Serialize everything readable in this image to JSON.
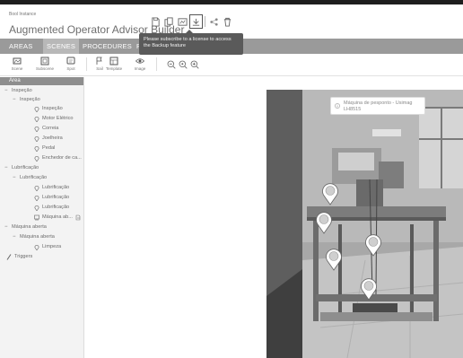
{
  "app": {
    "logo_text": "Bool Instance",
    "title": "Augmented Operator Advisor Builder"
  },
  "header": {
    "icons": [
      "save-icon",
      "copy-icon",
      "publish-icon",
      "backup-icon",
      "share-icon",
      "delete-icon"
    ]
  },
  "tooltip": {
    "text": "Please subscribe to a license to access the Backup feature"
  },
  "nav": {
    "tabs": [
      "AREAS",
      "SCENES",
      "PROCEDURES",
      "P"
    ]
  },
  "toolbar": {
    "tools": [
      "Scene",
      "Subscene",
      "Spot",
      "Sail",
      "Template",
      "Image"
    ]
  },
  "tree": {
    "root": "Area",
    "items": [
      "Inspeção",
      "Inspeção",
      "Inspeção",
      "Motor Elétrico",
      "Correia",
      "Joelheira",
      "Pedal",
      "Enchedor de ca...",
      "Lubrificação",
      "Lubrificação",
      "Lubrificação",
      "Lubrificação",
      "Lubrificação",
      "Máquina ab...",
      "Máquina aberta",
      "Máquina aberta",
      "Limpeza",
      "Triggers"
    ]
  },
  "viewport": {
    "info_text": "Máquina de pesponto - Usimag LH8515"
  },
  "colors": {
    "nav_bg": "#9a9a9a",
    "tooltip_bg": "#5a5a5a",
    "tree_root_bg": "#8e8e8e"
  }
}
